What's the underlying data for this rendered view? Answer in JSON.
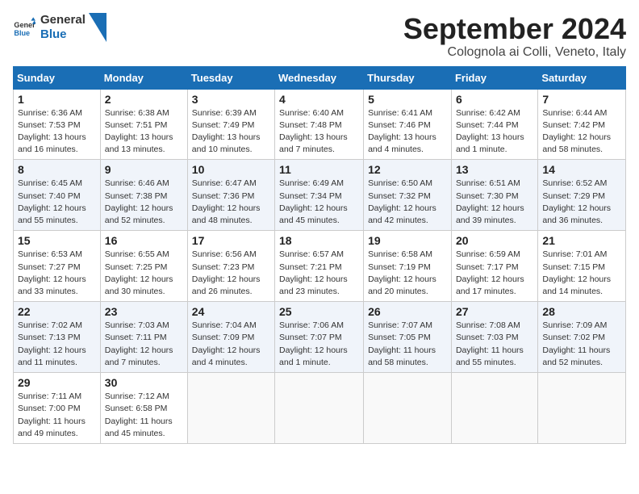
{
  "header": {
    "logo_line1": "General",
    "logo_line2": "Blue",
    "month": "September 2024",
    "location": "Colognola ai Colli, Veneto, Italy"
  },
  "weekdays": [
    "Sunday",
    "Monday",
    "Tuesday",
    "Wednesday",
    "Thursday",
    "Friday",
    "Saturday"
  ],
  "weeks": [
    [
      {
        "day": "1",
        "info": "Sunrise: 6:36 AM\nSunset: 7:53 PM\nDaylight: 13 hours\nand 16 minutes."
      },
      {
        "day": "2",
        "info": "Sunrise: 6:38 AM\nSunset: 7:51 PM\nDaylight: 13 hours\nand 13 minutes."
      },
      {
        "day": "3",
        "info": "Sunrise: 6:39 AM\nSunset: 7:49 PM\nDaylight: 13 hours\nand 10 minutes."
      },
      {
        "day": "4",
        "info": "Sunrise: 6:40 AM\nSunset: 7:48 PM\nDaylight: 13 hours\nand 7 minutes."
      },
      {
        "day": "5",
        "info": "Sunrise: 6:41 AM\nSunset: 7:46 PM\nDaylight: 13 hours\nand 4 minutes."
      },
      {
        "day": "6",
        "info": "Sunrise: 6:42 AM\nSunset: 7:44 PM\nDaylight: 13 hours\nand 1 minute."
      },
      {
        "day": "7",
        "info": "Sunrise: 6:44 AM\nSunset: 7:42 PM\nDaylight: 12 hours\nand 58 minutes."
      }
    ],
    [
      {
        "day": "8",
        "info": "Sunrise: 6:45 AM\nSunset: 7:40 PM\nDaylight: 12 hours\nand 55 minutes."
      },
      {
        "day": "9",
        "info": "Sunrise: 6:46 AM\nSunset: 7:38 PM\nDaylight: 12 hours\nand 52 minutes."
      },
      {
        "day": "10",
        "info": "Sunrise: 6:47 AM\nSunset: 7:36 PM\nDaylight: 12 hours\nand 48 minutes."
      },
      {
        "day": "11",
        "info": "Sunrise: 6:49 AM\nSunset: 7:34 PM\nDaylight: 12 hours\nand 45 minutes."
      },
      {
        "day": "12",
        "info": "Sunrise: 6:50 AM\nSunset: 7:32 PM\nDaylight: 12 hours\nand 42 minutes."
      },
      {
        "day": "13",
        "info": "Sunrise: 6:51 AM\nSunset: 7:30 PM\nDaylight: 12 hours\nand 39 minutes."
      },
      {
        "day": "14",
        "info": "Sunrise: 6:52 AM\nSunset: 7:29 PM\nDaylight: 12 hours\nand 36 minutes."
      }
    ],
    [
      {
        "day": "15",
        "info": "Sunrise: 6:53 AM\nSunset: 7:27 PM\nDaylight: 12 hours\nand 33 minutes."
      },
      {
        "day": "16",
        "info": "Sunrise: 6:55 AM\nSunset: 7:25 PM\nDaylight: 12 hours\nand 30 minutes."
      },
      {
        "day": "17",
        "info": "Sunrise: 6:56 AM\nSunset: 7:23 PM\nDaylight: 12 hours\nand 26 minutes."
      },
      {
        "day": "18",
        "info": "Sunrise: 6:57 AM\nSunset: 7:21 PM\nDaylight: 12 hours\nand 23 minutes."
      },
      {
        "day": "19",
        "info": "Sunrise: 6:58 AM\nSunset: 7:19 PM\nDaylight: 12 hours\nand 20 minutes."
      },
      {
        "day": "20",
        "info": "Sunrise: 6:59 AM\nSunset: 7:17 PM\nDaylight: 12 hours\nand 17 minutes."
      },
      {
        "day": "21",
        "info": "Sunrise: 7:01 AM\nSunset: 7:15 PM\nDaylight: 12 hours\nand 14 minutes."
      }
    ],
    [
      {
        "day": "22",
        "info": "Sunrise: 7:02 AM\nSunset: 7:13 PM\nDaylight: 12 hours\nand 11 minutes."
      },
      {
        "day": "23",
        "info": "Sunrise: 7:03 AM\nSunset: 7:11 PM\nDaylight: 12 hours\nand 7 minutes."
      },
      {
        "day": "24",
        "info": "Sunrise: 7:04 AM\nSunset: 7:09 PM\nDaylight: 12 hours\nand 4 minutes."
      },
      {
        "day": "25",
        "info": "Sunrise: 7:06 AM\nSunset: 7:07 PM\nDaylight: 12 hours\nand 1 minute."
      },
      {
        "day": "26",
        "info": "Sunrise: 7:07 AM\nSunset: 7:05 PM\nDaylight: 11 hours\nand 58 minutes."
      },
      {
        "day": "27",
        "info": "Sunrise: 7:08 AM\nSunset: 7:03 PM\nDaylight: 11 hours\nand 55 minutes."
      },
      {
        "day": "28",
        "info": "Sunrise: 7:09 AM\nSunset: 7:02 PM\nDaylight: 11 hours\nand 52 minutes."
      }
    ],
    [
      {
        "day": "29",
        "info": "Sunrise: 7:11 AM\nSunset: 7:00 PM\nDaylight: 11 hours\nand 49 minutes."
      },
      {
        "day": "30",
        "info": "Sunrise: 7:12 AM\nSunset: 6:58 PM\nDaylight: 11 hours\nand 45 minutes."
      },
      {
        "day": "",
        "info": ""
      },
      {
        "day": "",
        "info": ""
      },
      {
        "day": "",
        "info": ""
      },
      {
        "day": "",
        "info": ""
      },
      {
        "day": "",
        "info": ""
      }
    ]
  ]
}
